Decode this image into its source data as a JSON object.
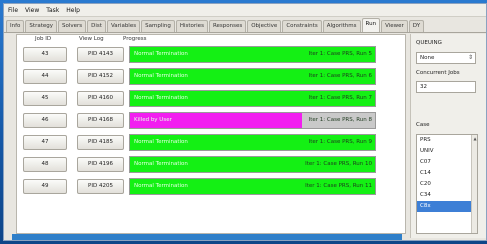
{
  "menu": [
    "File",
    "View",
    "Task",
    "Help"
  ],
  "tabs": [
    "Info",
    "Strategy",
    "Solvers",
    "Dist",
    "Variables",
    "Sampling",
    "Histories",
    "Responses",
    "Objective",
    "Constraints",
    "Algorithms",
    "Run",
    "Viewer",
    "DY"
  ],
  "active_tab": "Run",
  "columns": {
    "job_id": "Job ID",
    "view_log": "View Log",
    "progress": "Progress"
  },
  "jobs": [
    {
      "id": "43",
      "pid": "PID 4143",
      "status": "Normal Termination",
      "detail": "Iter 1: Case PRS, Run 5",
      "state": "normal",
      "progress": 1.0
    },
    {
      "id": "44",
      "pid": "PID 4152",
      "status": "Normal Termination",
      "detail": "Iter 1: Case PRS, Run 6",
      "state": "normal",
      "progress": 1.0
    },
    {
      "id": "45",
      "pid": "PID 4160",
      "status": "Normal Termination",
      "detail": "Iter 1: Case PRS, Run 7",
      "state": "normal",
      "progress": 1.0
    },
    {
      "id": "46",
      "pid": "PID 4168",
      "status": "Killed by User",
      "detail": "Iter 1: Case PRS, Run 8",
      "state": "killed",
      "progress": 0.7
    },
    {
      "id": "47",
      "pid": "PID 4185",
      "status": "Normal Termination",
      "detail": "Iter 1: Case PRS, Run 9",
      "state": "normal",
      "progress": 1.0
    },
    {
      "id": "48",
      "pid": "PID 4196",
      "status": "Normal Termination",
      "detail": "Iter 1: Case PRS, Run 10",
      "state": "normal",
      "progress": 1.0
    },
    {
      "id": "49",
      "pid": "PID 4205",
      "status": "Normal Termination",
      "detail": "Iter 1: Case PRS, Run 11",
      "state": "normal",
      "progress": 1.0
    }
  ],
  "colors": {
    "normal": "#14f014",
    "killed": "#f21ef0"
  },
  "side": {
    "queuing_label": "QUEUING",
    "queuing_value": "None",
    "concurrent_label": "Concurrent Jobs",
    "concurrent_value": "32",
    "case_label": "Case",
    "cases": [
      "PRS",
      "UNIV",
      "C07",
      "C14",
      "C20",
      "C34",
      "C8x"
    ],
    "selected_case": "C8x"
  }
}
